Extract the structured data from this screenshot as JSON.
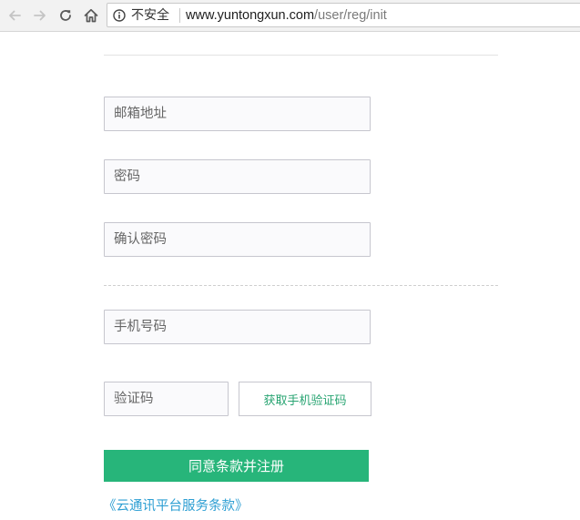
{
  "browser": {
    "security_label": "不安全",
    "url_host": "www.yuntongxun.com",
    "url_path": "/user/reg/init",
    "icons": {
      "back": "back-arrow-icon",
      "forward": "forward-arrow-icon",
      "reload": "reload-icon",
      "home": "home-icon",
      "security": "info-circle-icon"
    }
  },
  "form": {
    "email_placeholder": "邮箱地址",
    "password_placeholder": "密码",
    "confirm_password_placeholder": "确认密码",
    "phone_placeholder": "手机号码",
    "code_placeholder": "验证码",
    "get_code_label": "获取手机验证码",
    "submit_label": "同意条款并注册",
    "terms_link": "《云通讯平台服务条款》"
  },
  "colors": {
    "accent_green": "#27b57a",
    "link_blue": "#2e9fd3"
  }
}
